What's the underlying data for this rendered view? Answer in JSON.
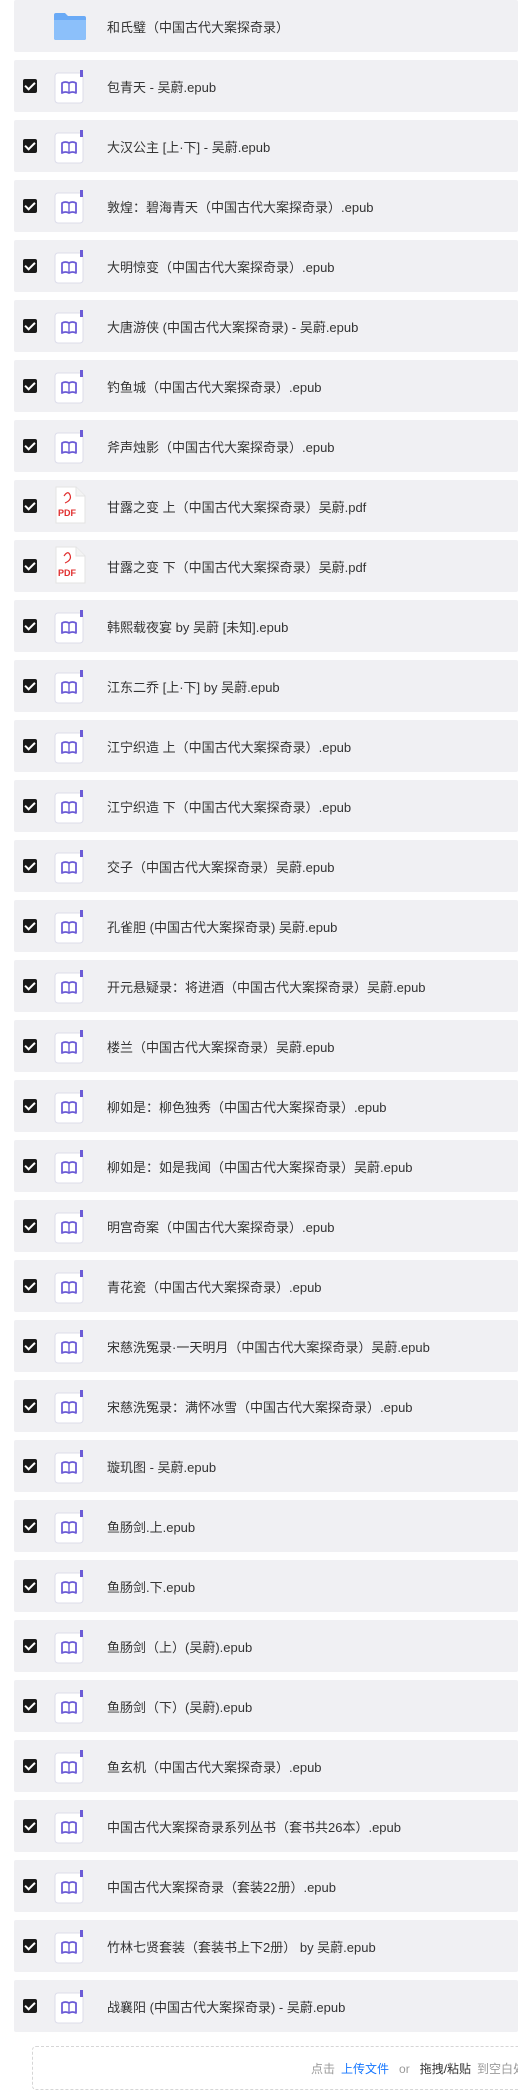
{
  "files": [
    {
      "name": "和氏璧（中国古代大案探奇录）",
      "type": "folder",
      "checked": false
    },
    {
      "name": "包青天 - 吴蔚.epub",
      "type": "epub",
      "checked": true
    },
    {
      "name": "大汉公主 [上·下] - 吴蔚.epub",
      "type": "epub",
      "checked": true
    },
    {
      "name": "敦煌：碧海青天（中国古代大案探奇录）.epub",
      "type": "epub",
      "checked": true
    },
    {
      "name": "大明惊变（中国古代大案探奇录）.epub",
      "type": "epub",
      "checked": true
    },
    {
      "name": "大唐游侠 (中国古代大案探奇录) - 吴蔚.epub",
      "type": "epub",
      "checked": true
    },
    {
      "name": "钓鱼城（中国古代大案探奇录）.epub",
      "type": "epub",
      "checked": true
    },
    {
      "name": "斧声烛影（中国古代大案探奇录）.epub",
      "type": "epub",
      "checked": true
    },
    {
      "name": "甘露之变 上（中国古代大案探奇录）吴蔚.pdf",
      "type": "pdf",
      "checked": true
    },
    {
      "name": "甘露之变 下（中国古代大案探奇录）吴蔚.pdf",
      "type": "pdf",
      "checked": true
    },
    {
      "name": "韩熙载夜宴 by 吴蔚 [未知].epub",
      "type": "epub",
      "checked": true
    },
    {
      "name": "江东二乔 [上·下] by 吴蔚.epub",
      "type": "epub",
      "checked": true
    },
    {
      "name": "江宁织造 上（中国古代大案探奇录）.epub",
      "type": "epub",
      "checked": true
    },
    {
      "name": "江宁织造 下（中国古代大案探奇录）.epub",
      "type": "epub",
      "checked": true
    },
    {
      "name": "交子（中国古代大案探奇录）吴蔚.epub",
      "type": "epub",
      "checked": true
    },
    {
      "name": "孔雀胆 (中国古代大案探奇录) 吴蔚.epub",
      "type": "epub",
      "checked": true
    },
    {
      "name": "开元悬疑录：将进酒（中国古代大案探奇录）吴蔚.epub",
      "type": "epub",
      "checked": true
    },
    {
      "name": "楼兰（中国古代大案探奇录）吴蔚.epub",
      "type": "epub",
      "checked": true
    },
    {
      "name": "柳如是：柳色独秀（中国古代大案探奇录）.epub",
      "type": "epub",
      "checked": true
    },
    {
      "name": "柳如是：如是我闻（中国古代大案探奇录）吴蔚.epub",
      "type": "epub",
      "checked": true
    },
    {
      "name": "明宫奇案（中国古代大案探奇录）.epub",
      "type": "epub",
      "checked": true
    },
    {
      "name": "青花瓷（中国古代大案探奇录）.epub",
      "type": "epub",
      "checked": true
    },
    {
      "name": "宋慈洗冤录·一天明月（中国古代大案探奇录）吴蔚.epub",
      "type": "epub",
      "checked": true
    },
    {
      "name": "宋慈洗冤录：满怀冰雪（中国古代大案探奇录）.epub",
      "type": "epub",
      "checked": true
    },
    {
      "name": "璇玑图 - 吴蔚.epub",
      "type": "epub",
      "checked": true
    },
    {
      "name": "鱼肠剑.上.epub",
      "type": "epub",
      "checked": true
    },
    {
      "name": "鱼肠剑.下.epub",
      "type": "epub",
      "checked": true
    },
    {
      "name": "鱼肠剑（上）(吴蔚).epub",
      "type": "epub",
      "checked": true
    },
    {
      "name": "鱼肠剑（下）(吴蔚).epub",
      "type": "epub",
      "checked": true
    },
    {
      "name": "鱼玄机（中国古代大案探奇录）.epub",
      "type": "epub",
      "checked": true
    },
    {
      "name": "中国古代大案探奇录系列丛书（套书共26本）.epub",
      "type": "epub",
      "checked": true
    },
    {
      "name": "中国古代大案探奇录（套装22册）.epub",
      "type": "epub",
      "checked": true
    },
    {
      "name": "竹林七贤套装（套装书上下2册） by 吴蔚.epub",
      "type": "epub",
      "checked": true
    },
    {
      "name": "战襄阳 (中国古代大案探奇录) - 吴蔚.epub",
      "type": "epub",
      "checked": true
    }
  ],
  "pdf_badge": "PDF",
  "upload": {
    "prefix": "点击",
    "link": "上传文件",
    "or": "or",
    "drag": "拖拽/粘贴",
    "suffix": "到空白处"
  },
  "colors": {
    "row_bg": "#f0f0f3",
    "epub_accent": "#6b5bd6",
    "pdf_red": "#e02e2e",
    "folder_blue": "#6aaaf6",
    "link_blue": "#1677ff"
  }
}
